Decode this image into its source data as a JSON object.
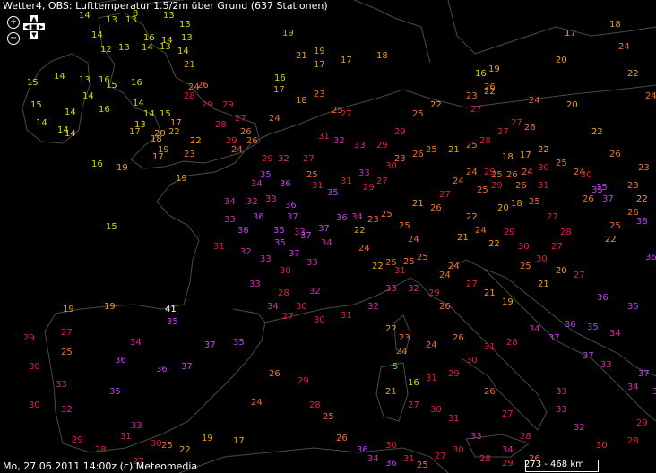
{
  "header": {
    "title": "Wetter4, OBS: Lufttemperatur 1.5/2m über Grund (637 Stationen)"
  },
  "footer": {
    "timestamp": "Mo, 27.06.2011 14:00z (c) Meteomedia"
  },
  "scale": {
    "label": "273 - 468 km"
  },
  "controls": {
    "zoom_in": "+",
    "zoom_out": "−"
  },
  "colors": {
    "background": "#000000",
    "coast": "#4a4a4a",
    "t_cool": "#d8d800",
    "t_mild": "#e8a020",
    "t_warm": "#f07030",
    "t_hot": "#e02040",
    "t_very_hot": "#d030a0",
    "t_extreme": "#c040f0"
  },
  "stations": [
    {
      "t": "14"
    },
    {
      "t": "13"
    },
    {
      "t": "13"
    },
    {
      "t": "8"
    },
    {
      "t": "13"
    },
    {
      "t": "13"
    },
    {
      "t": "14"
    },
    {
      "t": "16"
    },
    {
      "t": "14"
    },
    {
      "t": "13"
    },
    {
      "t": "12"
    },
    {
      "t": "13"
    },
    {
      "t": "14"
    },
    {
      "t": "13"
    },
    {
      "t": "14"
    },
    {
      "t": "15"
    },
    {
      "t": "14"
    },
    {
      "t": "13"
    },
    {
      "t": "16"
    },
    {
      "t": "21"
    },
    {
      "t": "15"
    },
    {
      "t": "14"
    },
    {
      "t": "14"
    },
    {
      "t": "15"
    },
    {
      "t": "16"
    },
    {
      "t": "24"
    },
    {
      "t": "14"
    },
    {
      "t": "14"
    },
    {
      "t": "15"
    },
    {
      "t": "14"
    },
    {
      "t": "16"
    },
    {
      "t": "13"
    },
    {
      "t": "14"
    },
    {
      "t": "14"
    },
    {
      "t": "17"
    },
    {
      "t": "20"
    },
    {
      "t": "18"
    },
    {
      "t": "19"
    },
    {
      "t": "22"
    },
    {
      "t": "17"
    },
    {
      "t": "16"
    },
    {
      "t": "19"
    },
    {
      "t": "15"
    },
    {
      "t": "19"
    },
    {
      "t": "17"
    },
    {
      "t": "23"
    },
    {
      "t": "22"
    },
    {
      "t": "19"
    },
    {
      "t": "21"
    },
    {
      "t": "19"
    },
    {
      "t": "16"
    },
    {
      "t": "17"
    },
    {
      "t": "18"
    },
    {
      "t": "17"
    },
    {
      "t": "17"
    },
    {
      "t": "18"
    },
    {
      "t": "23"
    },
    {
      "t": "25"
    },
    {
      "t": "27"
    },
    {
      "t": "24"
    },
    {
      "t": "28"
    },
    {
      "t": "29"
    },
    {
      "t": "26"
    },
    {
      "t": "29"
    },
    {
      "t": "27"
    },
    {
      "t": "26"
    },
    {
      "t": "28"
    },
    {
      "t": "29"
    },
    {
      "t": "26"
    },
    {
      "t": "24"
    },
    {
      "t": "31"
    },
    {
      "t": "32"
    },
    {
      "t": "33"
    },
    {
      "t": "29"
    },
    {
      "t": "29"
    },
    {
      "t": "25"
    },
    {
      "t": "22"
    },
    {
      "t": "23"
    },
    {
      "t": "26"
    },
    {
      "t": "27"
    },
    {
      "t": "30"
    },
    {
      "t": "33"
    },
    {
      "t": "31"
    },
    {
      "t": "29"
    },
    {
      "t": "27"
    },
    {
      "t": "23"
    },
    {
      "t": "26"
    },
    {
      "t": "25"
    },
    {
      "t": "21"
    },
    {
      "t": "25"
    },
    {
      "t": "28"
    },
    {
      "t": "27"
    },
    {
      "t": "27"
    },
    {
      "t": "26"
    },
    {
      "t": "29"
    },
    {
      "t": "18"
    },
    {
      "t": "17"
    },
    {
      "t": "22"
    },
    {
      "t": "25"
    },
    {
      "t": "24"
    },
    {
      "t": "20"
    },
    {
      "t": "22"
    },
    {
      "t": "26"
    },
    {
      "t": "23"
    },
    {
      "t": "22"
    },
    {
      "t": "16"
    },
    {
      "t": "19"
    },
    {
      "t": "22"
    },
    {
      "t": "24"
    },
    {
      "t": "20"
    },
    {
      "t": "17"
    },
    {
      "t": "18"
    },
    {
      "t": "24"
    },
    {
      "t": "22"
    },
    {
      "t": "24"
    },
    {
      "t": "23"
    },
    {
      "t": "26"
    },
    {
      "t": "26"
    },
    {
      "t": "25"
    },
    {
      "t": "22"
    },
    {
      "t": "29"
    },
    {
      "t": "32"
    },
    {
      "t": "27"
    },
    {
      "t": "25"
    },
    {
      "t": "31"
    },
    {
      "t": "35"
    },
    {
      "t": "34"
    },
    {
      "t": "33"
    },
    {
      "t": "34"
    },
    {
      "t": "32"
    },
    {
      "t": "36"
    },
    {
      "t": "33"
    },
    {
      "t": "36"
    },
    {
      "t": "36"
    },
    {
      "t": "37"
    },
    {
      "t": "33"
    },
    {
      "t": "37"
    },
    {
      "t": "34"
    },
    {
      "t": "36"
    },
    {
      "t": "34"
    },
    {
      "t": "31"
    },
    {
      "t": "32"
    },
    {
      "t": "33"
    },
    {
      "t": "35"
    },
    {
      "t": "35"
    },
    {
      "t": "37"
    },
    {
      "t": "37"
    },
    {
      "t": "33"
    },
    {
      "t": "36"
    },
    {
      "t": "35"
    },
    {
      "t": "30"
    },
    {
      "t": "32"
    },
    {
      "t": "28"
    },
    {
      "t": "33"
    },
    {
      "t": "34"
    },
    {
      "t": "30"
    },
    {
      "t": "19"
    },
    {
      "t": "19"
    },
    {
      "t": "41"
    },
    {
      "t": "35"
    },
    {
      "t": "37"
    },
    {
      "t": "35"
    },
    {
      "t": "34"
    },
    {
      "t": "36"
    },
    {
      "t": "36"
    },
    {
      "t": "37"
    },
    {
      "t": "35"
    },
    {
      "t": "33"
    },
    {
      "t": "31"
    },
    {
      "t": "30"
    },
    {
      "t": "27"
    },
    {
      "t": "25"
    },
    {
      "t": "29"
    },
    {
      "t": "30"
    },
    {
      "t": "33"
    },
    {
      "t": "32"
    },
    {
      "t": "30"
    },
    {
      "t": "29"
    },
    {
      "t": "28"
    },
    {
      "t": "27"
    },
    {
      "t": "25"
    },
    {
      "t": "22"
    },
    {
      "t": "19"
    },
    {
      "t": "17"
    },
    {
      "t": "24"
    },
    {
      "t": "26"
    },
    {
      "t": "29"
    },
    {
      "t": "28"
    },
    {
      "t": "25"
    },
    {
      "t": "26"
    },
    {
      "t": "27"
    },
    {
      "t": "30"
    },
    {
      "t": "31"
    },
    {
      "t": "32"
    },
    {
      "t": "33"
    },
    {
      "t": "31"
    },
    {
      "t": "32"
    },
    {
      "t": "29"
    },
    {
      "t": "26"
    },
    {
      "t": "24"
    },
    {
      "t": "24"
    },
    {
      "t": "22"
    },
    {
      "t": "25"
    },
    {
      "t": "25"
    },
    {
      "t": "25"
    },
    {
      "t": "24"
    },
    {
      "t": "25"
    },
    {
      "t": "25"
    },
    {
      "t": "23"
    },
    {
      "t": "22"
    },
    {
      "t": "22"
    },
    {
      "t": "23"
    },
    {
      "t": "24"
    },
    {
      "t": "5"
    },
    {
      "t": "16"
    },
    {
      "t": "21"
    },
    {
      "t": "27"
    },
    {
      "t": "24"
    },
    {
      "t": "26"
    },
    {
      "t": "30"
    },
    {
      "t": "31"
    },
    {
      "t": "28"
    },
    {
      "t": "34"
    },
    {
      "t": "37"
    },
    {
      "t": "36"
    },
    {
      "t": "35"
    },
    {
      "t": "34"
    },
    {
      "t": "37"
    },
    {
      "t": "33"
    },
    {
      "t": "34"
    },
    {
      "t": "30"
    },
    {
      "t": "35"
    },
    {
      "t": "37"
    },
    {
      "t": "35"
    },
    {
      "t": "38"
    },
    {
      "t": "36"
    },
    {
      "t": "36"
    },
    {
      "t": "35"
    },
    {
      "t": "37"
    },
    {
      "t": "39"
    },
    {
      "t": "33"
    },
    {
      "t": "33"
    },
    {
      "t": "32"
    },
    {
      "t": "30"
    },
    {
      "t": "28"
    },
    {
      "t": "29"
    },
    {
      "t": "25"
    },
    {
      "t": "21"
    },
    {
      "t": "20"
    },
    {
      "t": "27"
    },
    {
      "t": "30"
    },
    {
      "t": "31"
    },
    {
      "t": "33"
    },
    {
      "t": "34"
    },
    {
      "t": "28"
    },
    {
      "t": "27"
    },
    {
      "t": "26"
    },
    {
      "t": "29"
    },
    {
      "t": "31"
    },
    {
      "t": "30"
    },
    {
      "t": "36"
    },
    {
      "t": "34"
    },
    {
      "t": "36"
    },
    {
      "t": "31"
    },
    {
      "t": "25"
    },
    {
      "t": "27"
    },
    {
      "t": "30"
    },
    {
      "t": "28"
    },
    {
      "t": "29"
    },
    {
      "t": "26"
    },
    {
      "t": "24"
    },
    {
      "t": "27"
    },
    {
      "t": "21"
    },
    {
      "t": "19"
    },
    {
      "t": "22"
    },
    {
      "t": "24"
    },
    {
      "t": "21"
    },
    {
      "t": "22"
    },
    {
      "t": "20"
    },
    {
      "t": "18"
    },
    {
      "t": "26"
    },
    {
      "t": "25"
    },
    {
      "t": "27"
    },
    {
      "t": "28"
    },
    {
      "t": "27"
    },
    {
      "t": "30"
    },
    {
      "t": "30"
    },
    {
      "t": "29"
    },
    {
      "t": "29"
    },
    {
      "t": "31"
    },
    {
      "t": "21"
    },
    {
      "t": "26"
    },
    {
      "t": "27"
    },
    {
      "t": "24"
    },
    {
      "t": "24"
    },
    {
      "t": "25"
    },
    {
      "t": "25"
    },
    {
      "t": "26"
    },
    {
      "t": "24"
    },
    {
      "t": "30"
    }
  ]
}
